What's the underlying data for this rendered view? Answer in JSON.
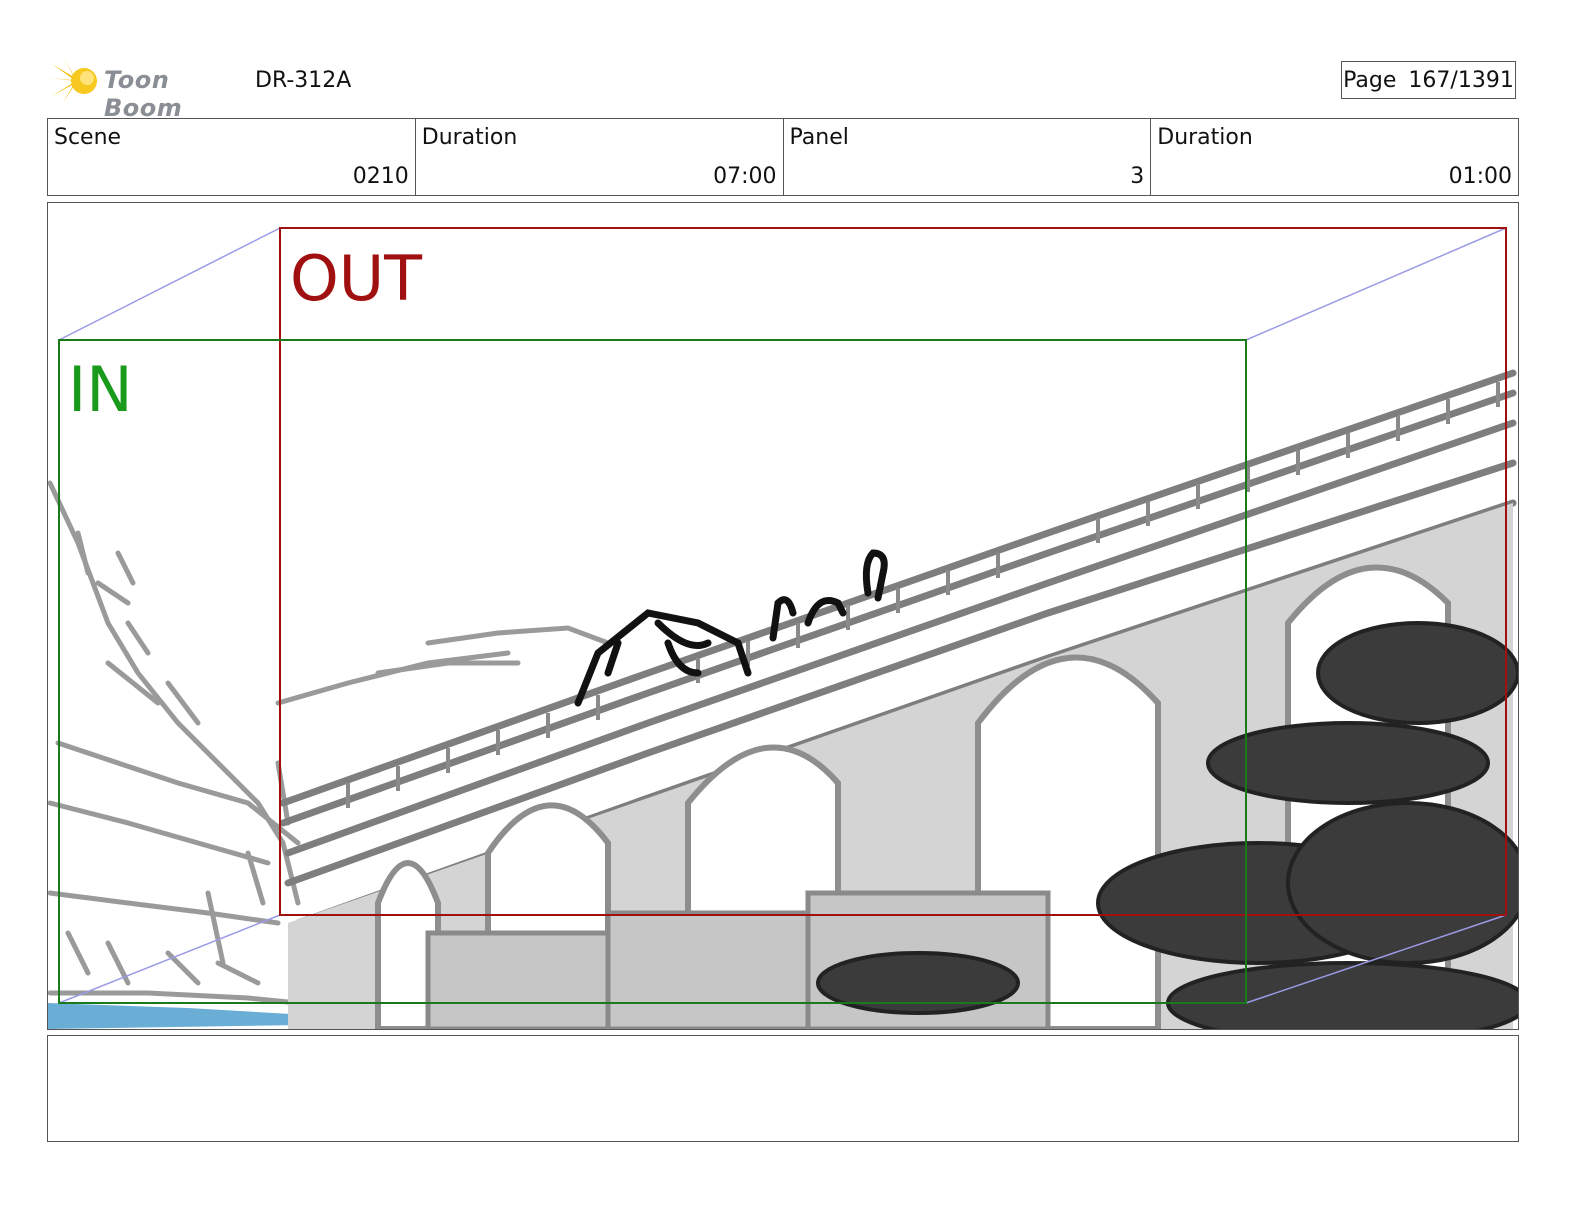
{
  "header": {
    "logo_text": "Toon Boom",
    "project_code": "DR-312A",
    "page_label": "Page",
    "page_number": "167/1391"
  },
  "info": {
    "scene_label": "Scene",
    "scene_value": "0210",
    "scene_duration_label": "Duration",
    "scene_duration_value": "07:00",
    "panel_label": "Panel",
    "panel_value": "3",
    "panel_duration_label": "Duration",
    "panel_duration_value": "01:00"
  },
  "panel": {
    "in_label": "IN",
    "out_label": "OUT",
    "in_color": "#1a9a1a",
    "out_color": "#a01010"
  },
  "notes": {
    "text": ""
  }
}
